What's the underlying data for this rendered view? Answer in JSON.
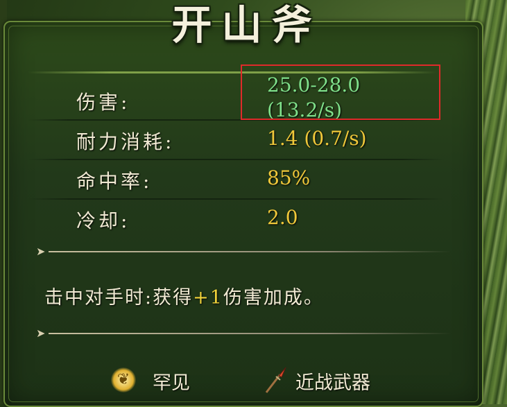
{
  "item": {
    "title": "开山斧",
    "stats": [
      {
        "label": "伤害:",
        "value_line1": "25.0-28.0",
        "value_line2": "(13.2/s)"
      },
      {
        "label": "耐力消耗:",
        "value": "1.4 (0.7/s)"
      },
      {
        "label": "命中率:",
        "value": "85%"
      },
      {
        "label": "冷却:",
        "value": "2.0"
      }
    ],
    "effect": {
      "prefix": "击中对手时:获得",
      "bonus": "+1",
      "suffix": "伤害加成。"
    },
    "rarity": {
      "label": "罕见",
      "icon": "rarity-wings-icon"
    },
    "weapon_type": {
      "label": "近战武器",
      "icon": "spear-icon"
    }
  },
  "colors": {
    "value_gold": "#f0c83a",
    "highlight_green": "#7fe08a",
    "label_cream": "#f1ead3",
    "annotation_red": "#e02a2a",
    "panel_green": "#2d4a1a"
  }
}
